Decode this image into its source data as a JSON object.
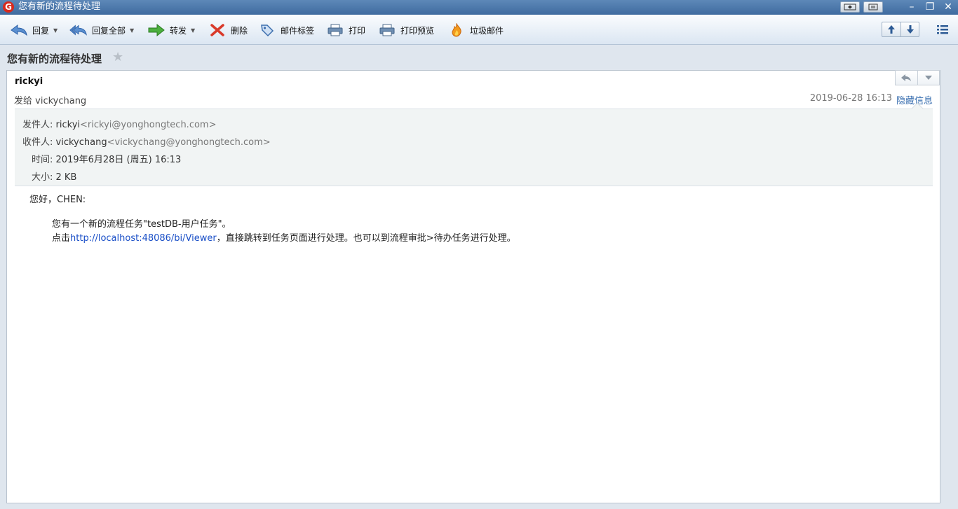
{
  "window": {
    "title": "您有新的流程待处理"
  },
  "toolbar": {
    "reply": "回复",
    "reply_all": "回复全部",
    "forward": "转发",
    "delete": "删除",
    "mail_tag": "邮件标签",
    "print": "打印",
    "print_preview": "打印预览",
    "spam": "垃圾邮件"
  },
  "mail": {
    "subject": "您有新的流程待处理",
    "sender_name": "rickyi",
    "sent_to": "发给 vickychang",
    "datetime": "2019-06-28 16:13",
    "hide_info": "隐藏信息",
    "details": {
      "from_label": "发件人:",
      "from_name": "rickyi",
      "from_addr": "<rickyi@yonghongtech.com>",
      "to_label": "收件人:",
      "to_name": "vickychang",
      "to_addr": "<vickychang@yonghongtech.com>",
      "time_label": "时间:",
      "time_value": "2019年6月28日 (周五) 16:13",
      "size_label": "大小:",
      "size_value": "2 KB"
    },
    "body": {
      "greeting": "您好，CHEN:",
      "line1": "您有一个新的流程任务\"testDB-用户任务\"。",
      "line2_prefix": "点击",
      "line2_link": "http://localhost:48086/bi/Viewer",
      "line2_suffix": "，直接跳转到任务页面进行处理。也可以到流程审批>待办任务进行处理。"
    }
  },
  "colors": {
    "title_bar": "#4a76a8",
    "link": "#1a4fc7",
    "logo_red": "#d82a1e"
  },
  "icons": [
    "app-logo-icon",
    "reply-icon",
    "reply-all-icon",
    "forward-icon",
    "delete-icon",
    "tag-icon",
    "print-icon",
    "print-preview-icon",
    "spam-icon",
    "arrow-up-icon",
    "arrow-down-icon",
    "list-icon",
    "star-icon"
  ]
}
